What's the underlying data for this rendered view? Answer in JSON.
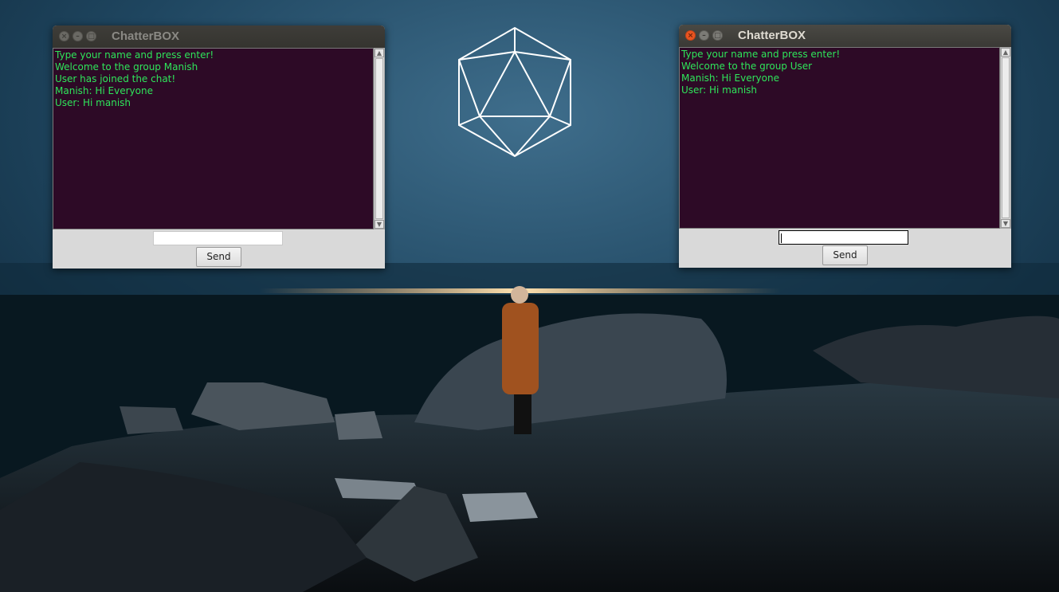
{
  "wallpaper": {
    "description_icon": "icosahedron-logo"
  },
  "windows": [
    {
      "title": "ChatterBOX",
      "messages": [
        "Type your name and press enter!",
        "Welcome to the group Manish",
        "User has joined the chat!",
        "Manish: Hi Everyone",
        "User: Hi manish"
      ],
      "input_value": "",
      "send_label": "Send",
      "active": false
    },
    {
      "title": "ChatterBOX",
      "messages": [
        "Type your name and press enter!",
        "Welcome to the group User",
        "Manish: Hi Everyone",
        "User: Hi manish"
      ],
      "input_value": "",
      "send_label": "Send",
      "active": true
    }
  ],
  "colors": {
    "chat_bg": "#2d0a26",
    "chat_text": "#2ee55a",
    "close_active": "#e95420"
  }
}
